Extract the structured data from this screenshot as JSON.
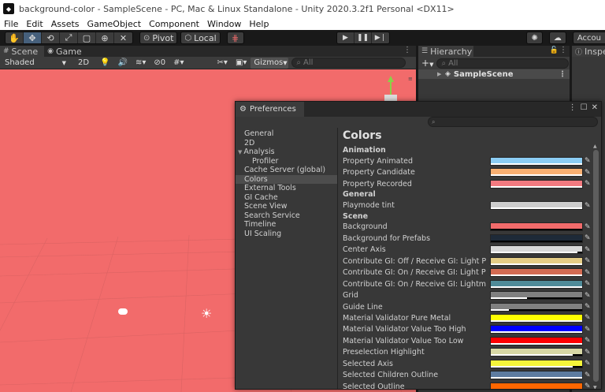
{
  "window": {
    "title": "background-color - SampleScene - PC, Mac & Linux Standalone - Unity 2020.3.2f1 Personal <DX11>",
    "app_icon": "unity-icon"
  },
  "menu": [
    "File",
    "Edit",
    "Assets",
    "GameObject",
    "Component",
    "Window",
    "Help"
  ],
  "toolbar": {
    "tools": [
      "hand-tool-icon",
      "move-tool-icon",
      "rotate-tool-icon",
      "scale-tool-icon",
      "rect-tool-icon",
      "transform-tool-icon",
      "custom-tool-icon"
    ],
    "active_tool": "move-tool-icon",
    "pivot_label": "Pivot",
    "local_label": "Local",
    "play_icons": [
      "play-icon",
      "pause-icon",
      "step-icon"
    ],
    "right_label": "Accou"
  },
  "scene": {
    "tabs": [
      "Scene",
      "Game"
    ],
    "shading": "Shaded",
    "mode_2d": "2D",
    "hidden_count": "0",
    "gizmos": "Gizmos",
    "search_placeholder": "All",
    "background_color": "#f26b6b"
  },
  "hierarchy": {
    "tab": "Hierarchy",
    "add_label": "+",
    "search_placeholder": "All",
    "scene_name": "SampleScene"
  },
  "inspector": {
    "tab": "Inspe"
  },
  "preferences": {
    "tab": "Preferences",
    "nav": [
      {
        "label": "General",
        "child": false,
        "arrow": false
      },
      {
        "label": "2D",
        "child": false,
        "arrow": false
      },
      {
        "label": "Analysis",
        "child": false,
        "arrow": true
      },
      {
        "label": "Profiler",
        "child": true,
        "arrow": false
      },
      {
        "label": "Cache Server (global)",
        "child": false,
        "arrow": false
      },
      {
        "label": "Colors",
        "child": false,
        "arrow": false,
        "selected": true
      },
      {
        "label": "External Tools",
        "child": false,
        "arrow": false
      },
      {
        "label": "GI Cache",
        "child": false,
        "arrow": false
      },
      {
        "label": "Scene View",
        "child": false,
        "arrow": false
      },
      {
        "label": "Search Service",
        "child": false,
        "arrow": false
      },
      {
        "label": "Timeline",
        "child": false,
        "arrow": false
      },
      {
        "label": "UI Scaling",
        "child": false,
        "arrow": false
      }
    ],
    "content_title": "Colors",
    "sections": [
      {
        "heading": "Animation",
        "rows": [
          {
            "label": "Property Animated",
            "color": "#8ccdf4",
            "alpha": 1.0
          },
          {
            "label": "Property Candidate",
            "color": "#f8b072",
            "alpha": 1.0
          },
          {
            "label": "Property Recorded",
            "color": "#f27a80",
            "alpha": 1.0
          }
        ]
      },
      {
        "heading": "General",
        "rows": [
          {
            "label": "Playmode tint",
            "color": "#cccccc",
            "alpha": 1.0
          }
        ]
      },
      {
        "heading": "Scene",
        "rows": [
          {
            "label": "Background",
            "color": "#f26b6b",
            "alpha": 0.0
          },
          {
            "label": "Background for Prefabs",
            "color": "#1e2a38",
            "alpha": 0.0
          },
          {
            "label": "Center Axis",
            "color": "#d8d8d8",
            "alpha": 0.95
          },
          {
            "label": "Contribute GI: Off / Receive GI: Light Probes",
            "color": "#e5cd86",
            "alpha": 1.0
          },
          {
            "label": "Contribute GI: On / Receive GI: Light Probes",
            "color": "#d46b52",
            "alpha": 1.0
          },
          {
            "label": "Contribute GI: On / Receive GI: Lightmaps",
            "color": "#4f8b99",
            "alpha": 1.0
          },
          {
            "label": "Grid",
            "color": "#808080",
            "alpha": 0.4
          },
          {
            "label": "Guide Line",
            "color": "#808080",
            "alpha": 0.2
          },
          {
            "label": "Material Validator Pure Metal",
            "color": "#ffff00",
            "alpha": 1.0
          },
          {
            "label": "Material Validator Value Too High",
            "color": "#0000ff",
            "alpha": 1.0
          },
          {
            "label": "Material Validator Value Too Low",
            "color": "#ff0000",
            "alpha": 1.0
          },
          {
            "label": "Preselection Highlight",
            "color": "#d8d8a6",
            "alpha": 0.9
          },
          {
            "label": "Selected Axis",
            "color": "#f5f53a",
            "alpha": 0.9
          },
          {
            "label": "Selected Children Outline",
            "color": "#5e7ca0",
            "alpha": 1.0
          },
          {
            "label": "Selected Outline",
            "color": "#ff6600",
            "alpha": 1.0
          }
        ]
      }
    ]
  }
}
